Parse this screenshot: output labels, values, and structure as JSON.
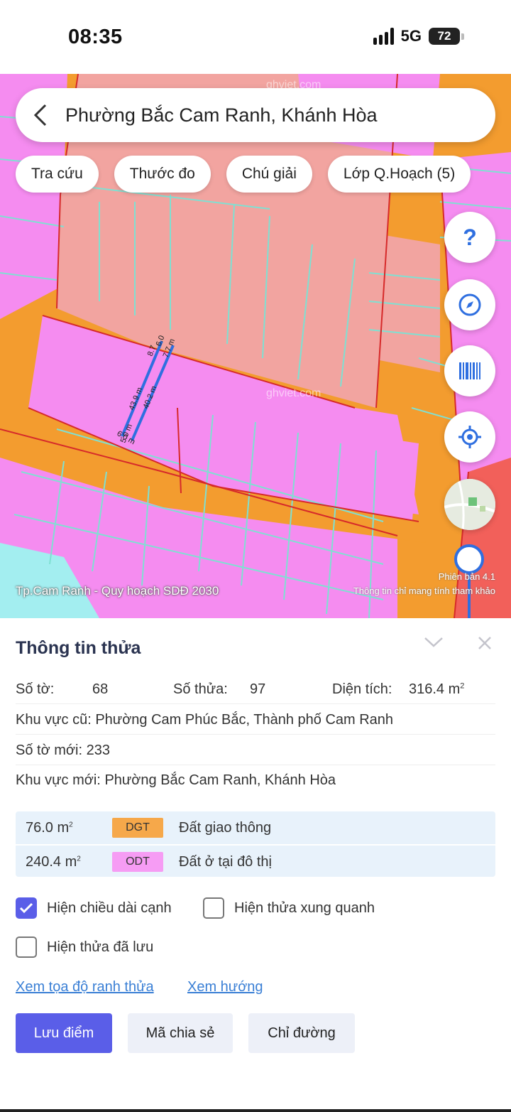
{
  "status_bar": {
    "time": "08:35",
    "network": "5G",
    "battery": "72"
  },
  "search": {
    "text": "Phường Bắc Cam Ranh, Khánh Hòa"
  },
  "chips": [
    "Tra cứu",
    "Thước đo",
    "Chú giải",
    "Lớp Q.Hoạch (5)"
  ],
  "map": {
    "caption": "Tp.Cam Ranh - Quy hoạch SDĐ 2030",
    "version": "Phiên bản 4.1",
    "disclaimer": "Thông tin chỉ mang tính tham khảo",
    "watermark": "ghviet.com",
    "measure_labels": [
      "8.7",
      "6.0",
      "7.7 m",
      "43.9 m",
      "40.2 m",
      "6.0 m",
      "5.0 m"
    ],
    "colors": {
      "road": "#f39c2f",
      "residential": "#f58cf0",
      "commercial": "#f2a4a0",
      "parcel_line": "#7fe0d2",
      "boundary": "#d62a2a",
      "water": "#a3eef0",
      "measure": "#2f6fe0"
    }
  },
  "fab": {
    "help": "?",
    "icons": [
      "help-icon",
      "compass-icon",
      "barcode-icon",
      "locate-icon",
      "layer-thumbnail"
    ]
  },
  "panel": {
    "title": "Thông tin thửa",
    "so_to_label": "Số tờ:",
    "so_to": "68",
    "so_thua_label": "Số thửa:",
    "so_thua": "97",
    "dien_tich_label": "Diện tích:",
    "dien_tich": "316.4 m",
    "dien_tich_sup": "2",
    "khu_vuc_cu_label": "Khu vực cũ:",
    "khu_vuc_cu": "Phường Cam Phúc Bắc, Thành phố Cam Ranh",
    "so_to_moi_label": "Số tờ mới:",
    "so_to_moi": "233",
    "khu_vuc_moi_label": "Khu vực mới:",
    "khu_vuc_moi": "Phường Bắc Cam Ranh, Khánh Hòa",
    "usage": [
      {
        "area": "76.0 m",
        "sup": "2",
        "code": "DGT",
        "name": "Đất giao thông",
        "color": "#f6a84a"
      },
      {
        "area": "240.4 m",
        "sup": "2",
        "code": "ODT",
        "name": "Đất ở tại đô thị",
        "color": "#f69cf4"
      }
    ],
    "checkboxes": [
      {
        "label": "Hiện chiều dài cạnh",
        "checked": true
      },
      {
        "label": "Hiện thửa xung quanh",
        "checked": false
      },
      {
        "label": "Hiện thửa đã lưu",
        "checked": false
      }
    ],
    "links": [
      "Xem tọa độ ranh thửa",
      "Xem hướng"
    ],
    "buttons": [
      "Lưu điểm",
      "Mã chia sẻ",
      "Chỉ đường"
    ]
  }
}
